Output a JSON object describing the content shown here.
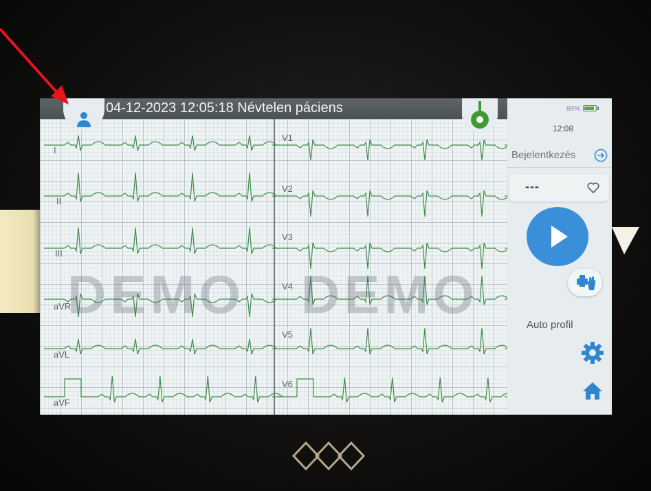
{
  "header": {
    "title": "04-12-2023 12:05:18 Névtelen páciens"
  },
  "ecg": {
    "leads_left": [
      "I",
      "II",
      "III",
      "aVR",
      "aVL",
      "aVF"
    ],
    "leads_right": [
      "V1",
      "V2",
      "V3",
      "V4",
      "V5",
      "V6"
    ],
    "watermark": "DEMO",
    "trace_color": "#3f8a4a"
  },
  "panel": {
    "battery": "89%",
    "battery_level": 0.89,
    "time": "12:08",
    "login_label": "Bejelentkezés",
    "heart_rate": "---",
    "auto_profile": "Auto profil"
  },
  "icons": {
    "patient": "user-icon",
    "lead": "lead-electrode-icon",
    "login": "arrow-right-circle-icon",
    "heart": "heart-icon",
    "play": "play-icon",
    "print": "print-hand-icon",
    "settings": "gear-icon",
    "home": "home-icon",
    "annotation": "red-arrow"
  },
  "colors": {
    "accent": "#3b8fd8",
    "header": "#4f565a",
    "lead_ok": "#4fb23a",
    "annotation": "#e8141c"
  }
}
